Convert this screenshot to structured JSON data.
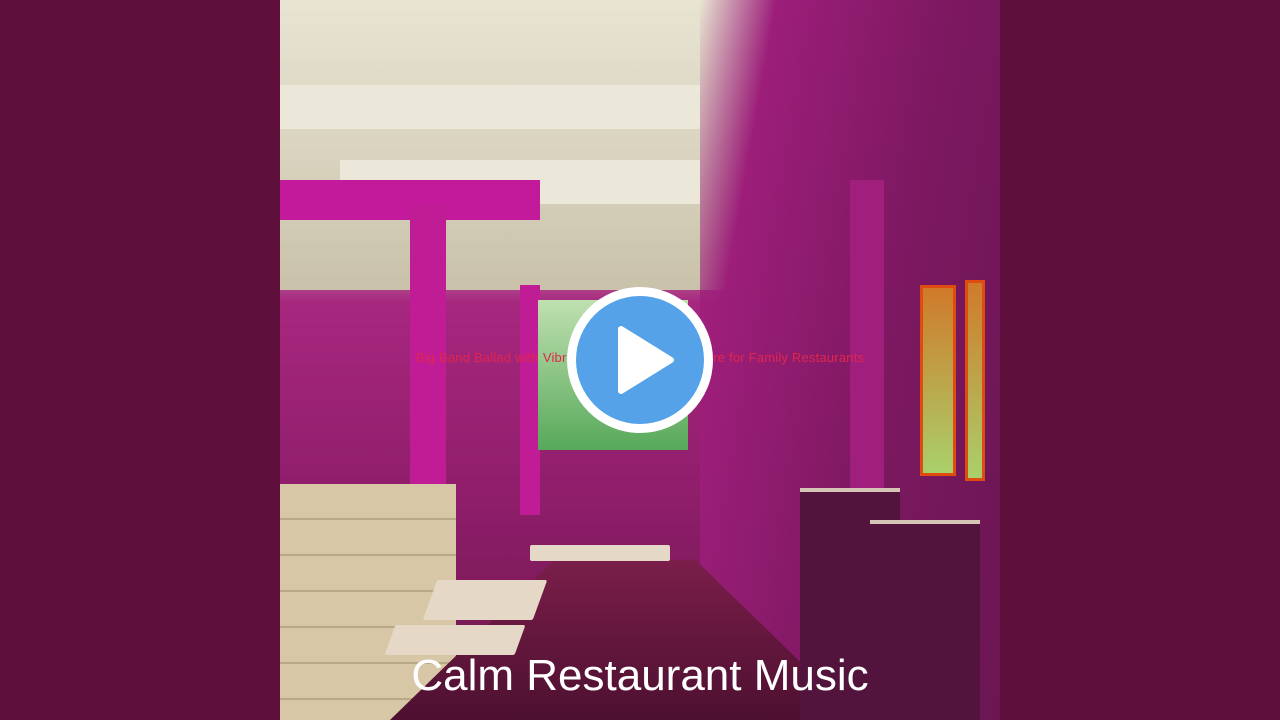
{
  "player": {
    "title": "Big Band Ballad with Vibraphone Solo - Atmosphere for Family Restaurants",
    "play_icon": "play-icon",
    "colors": {
      "background": "#5e0f3c",
      "play_circle": "#55a2e8",
      "title_text": "#e1264e",
      "caption_text": "#ffffff"
    }
  },
  "thumbnail": {
    "caption": "Calm Restaurant Music"
  }
}
